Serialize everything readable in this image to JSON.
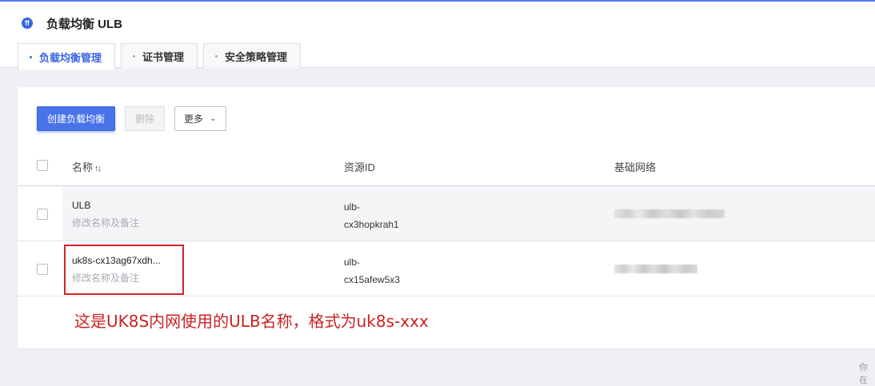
{
  "header": {
    "icon": "ulb-logo-icon",
    "title": "负载均衡 ULB",
    "tabs": [
      {
        "label": "负载均衡管理",
        "active": true
      },
      {
        "label": "证书管理",
        "active": false
      },
      {
        "label": "安全策略管理",
        "active": false
      }
    ]
  },
  "toolbar": {
    "create_label": "创建负载均衡",
    "delete_label": "删除",
    "more_label": "更多"
  },
  "table": {
    "columns": [
      "名称",
      "资源ID",
      "基础网络"
    ],
    "rows": [
      {
        "name": "ULB",
        "edit_label": "修改名称及备注",
        "res_id_line1": "ulb-",
        "res_id_line2": "cx3hopkrah1"
      },
      {
        "name": "uk8s-cx13ag67xdh...",
        "edit_label": "修改名称及备注",
        "res_id_line1": "ulb-",
        "res_id_line2": "cx15afew5x3"
      }
    ]
  },
  "annotation": "这是UK8S内网使用的ULB名称，格式为uk8s-xxx",
  "corner_text": "你在",
  "colors": {
    "accent": "#3a63e3",
    "annotation": "#cc2222"
  }
}
